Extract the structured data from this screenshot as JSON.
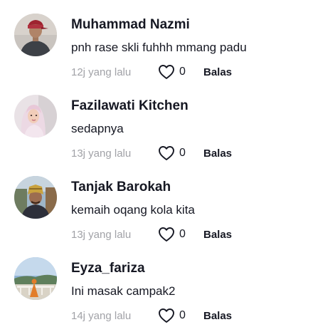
{
  "comments": [
    {
      "username": "Muhammad Nazmi",
      "text": "pnh rase skli fuhhh mmang padu",
      "time": "12j yang lalu",
      "likes": "0",
      "reply_label": "Balas",
      "avatar_icon": "user-avatar"
    },
    {
      "username": "Fazilawati Kitchen",
      "text": "sedapnya",
      "time": "13j yang lalu",
      "likes": "0",
      "reply_label": "Balas",
      "avatar_icon": "user-avatar"
    },
    {
      "username": "Tanjak Barokah",
      "text": "kemaih oqang kola kita",
      "time": "13j yang lalu",
      "likes": "0",
      "reply_label": "Balas",
      "avatar_icon": "user-avatar"
    },
    {
      "username": "Eyza_fariza",
      "text": "Ini masak campak2",
      "time": "14j yang lalu",
      "likes": "0",
      "reply_label": "Balas",
      "avatar_icon": "user-avatar"
    }
  ],
  "colors": {
    "text_primary": "#161823",
    "text_secondary": "#a1a2a7",
    "background": "#ffffff"
  }
}
